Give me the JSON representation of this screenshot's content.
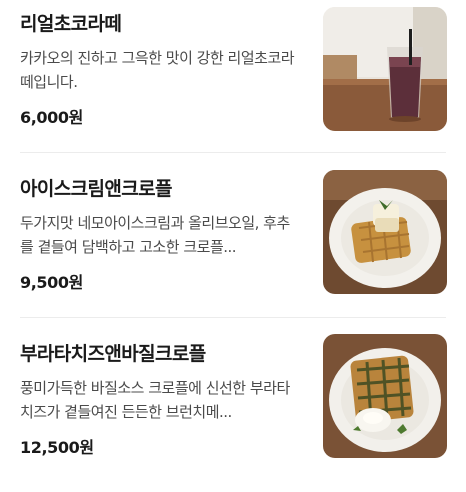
{
  "items": [
    {
      "name": "리얼초코라떼",
      "description": "카카오의 진하고 그윽한 맛이 강한 리얼초코라떼입니다.",
      "price": "6,000원",
      "thumbnail_icon": "chocolate-latte-photo"
    },
    {
      "name": "아이스크림앤크로플",
      "description": "두가지맛 네모아이스크림과 올리브오일, 후추를 곁들여 담백하고 고소한 크로플...",
      "price": "9,500원",
      "thumbnail_icon": "croffle-icecream-photo"
    },
    {
      "name": "부라타치즈앤바질크로플",
      "description": "풍미가득한 바질소스 크로플에 신선한 부라타치즈가 곁들여진 든든한 브런치메...",
      "price": "12,500원",
      "thumbnail_icon": "croffle-burrata-photo"
    }
  ]
}
